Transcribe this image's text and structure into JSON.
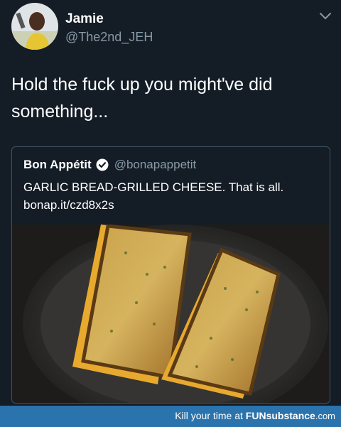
{
  "tweet": {
    "author_name": "Jamie",
    "author_handle": "@The2nd_JEH",
    "text": "Hold the fuck up you might've did something...",
    "menu_icon": "chevron-down-icon"
  },
  "quoted_tweet": {
    "author_name": "Bon Appétit",
    "verified_icon": "verified-badge-icon",
    "author_handle": "@bonapappetit",
    "text_line1": "GARLIC BREAD-GRILLED CHEESE. That is all.",
    "link": "bonap.it/czd8x2s",
    "image_subject": "garlic bread grilled cheese in a cast-iron pan"
  },
  "watermark": {
    "prefix": "Kill your time at ",
    "brand": "FUNsubstance",
    "suffix": ".com"
  },
  "colors": {
    "background": "#141d26",
    "muted_text": "#8899a6",
    "card_border": "#3d5466",
    "verified_blue": "#1da1f2",
    "footer_bar": "#2a73ad"
  }
}
